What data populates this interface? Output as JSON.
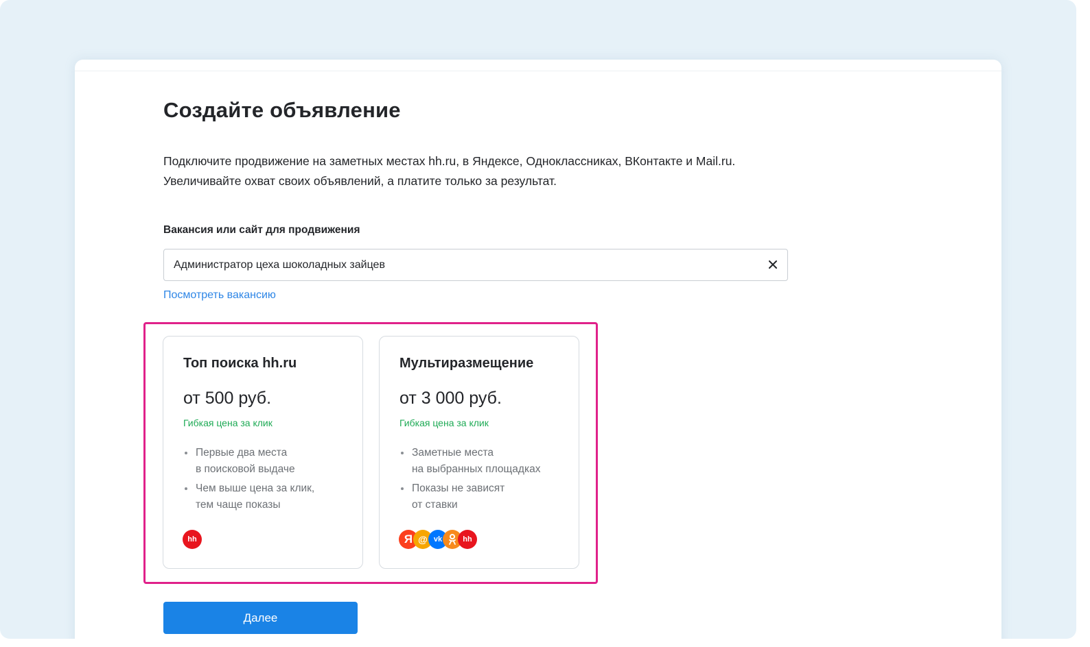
{
  "page": {
    "title": "Создайте объявление",
    "description": [
      "Подключите продвижение на заметных местах hh.ru, в Яндексе, Одноклассниках, ВКонтакте и Mail.ru.",
      "Увеличивайте охват своих объявлений, а платите только за результат."
    ]
  },
  "form": {
    "field_label": "Вакансия или сайт для продвижения",
    "field_value": "Администратор цеха шоколадных зайцев",
    "view_link": "Посмотреть вакансию"
  },
  "options": [
    {
      "title": "Топ поиска hh.ru",
      "price": "от 500 руб.",
      "note": "Гибкая цена за клик",
      "bullets": [
        [
          "Первые два места",
          "в поисковой выдаче"
        ],
        [
          "Чем выше цена за клик,",
          "тем чаще показы"
        ]
      ],
      "logos": [
        "hh"
      ]
    },
    {
      "title": "Мультиразмещение",
      "price": "от 3 000 руб.",
      "note": "Гибкая цена за клик",
      "bullets": [
        [
          "Заметные места",
          "на выбранных площадках"
        ],
        [
          "Показы не зависят",
          "от ставки"
        ]
      ],
      "logos": [
        "Я",
        "@",
        "vk",
        "ok",
        "hh"
      ]
    }
  ],
  "next_button": "Далее",
  "icons": {
    "clear": "close-icon",
    "logo_hh": "hh-logo-icon",
    "logo_yandex": "yandex-logo-icon",
    "logo_mail": "mail-logo-icon",
    "logo_vk": "vk-logo-icon",
    "logo_ok": "ok-logo-icon"
  },
  "colors": {
    "accent": "#1a83e6",
    "link": "#2e86e6",
    "note_green": "#1eaa55",
    "highlight": "#e0218a",
    "hh_red": "#e8151e"
  }
}
